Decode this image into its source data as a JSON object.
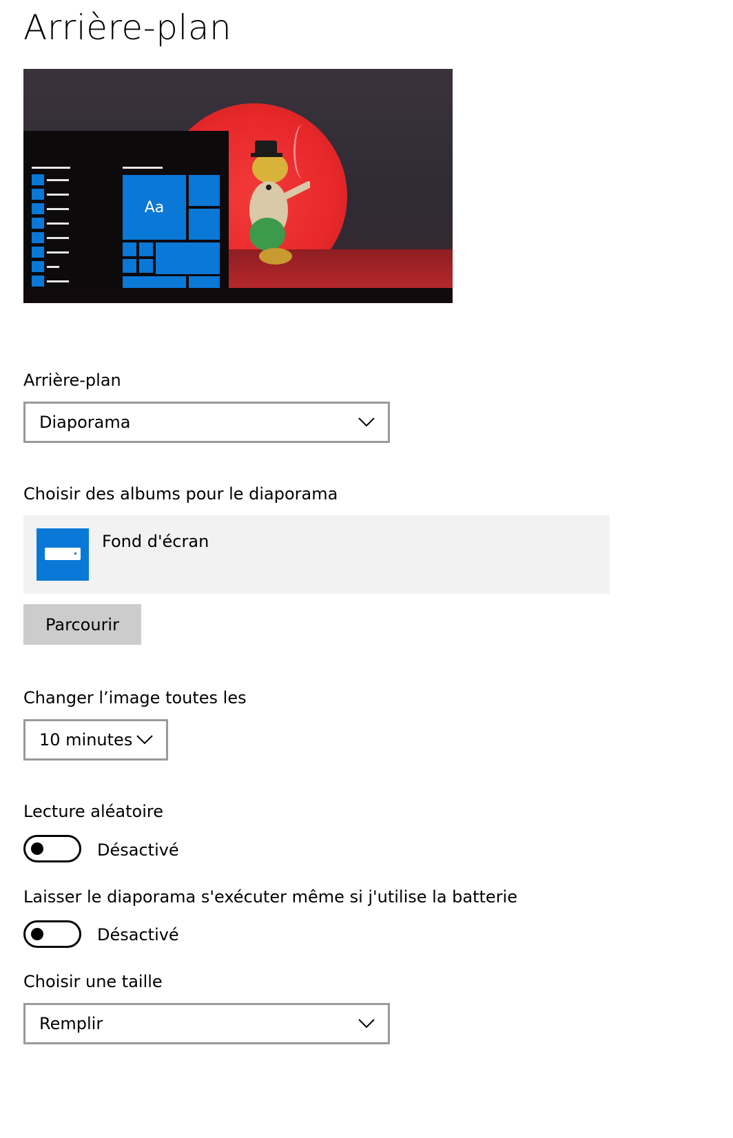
{
  "page": {
    "title": "Arrière-plan"
  },
  "preview": {
    "tile_text": "Aa"
  },
  "background": {
    "label": "Arrière-plan",
    "selected": "Diaporama"
  },
  "albums": {
    "label": "Choisir des albums pour le diaporama",
    "items": [
      {
        "name": "Fond d'écran",
        "icon": "drive-icon"
      }
    ],
    "browse_label": "Parcourir"
  },
  "interval": {
    "label": "Changer l’image toutes les",
    "selected": "10 minutes"
  },
  "shuffle": {
    "label": "Lecture aléatoire",
    "state": "Désactivé",
    "on": false
  },
  "battery": {
    "label": "Laisser le diaporama s'exécuter même si j'utilise la batterie",
    "state": "Désactivé",
    "on": false
  },
  "fit": {
    "label": "Choisir une taille",
    "selected": "Remplir"
  },
  "colors": {
    "accent": "#0a78d7",
    "border": "#999999",
    "panel": "#f2f2f2",
    "button": "#cccccc"
  }
}
